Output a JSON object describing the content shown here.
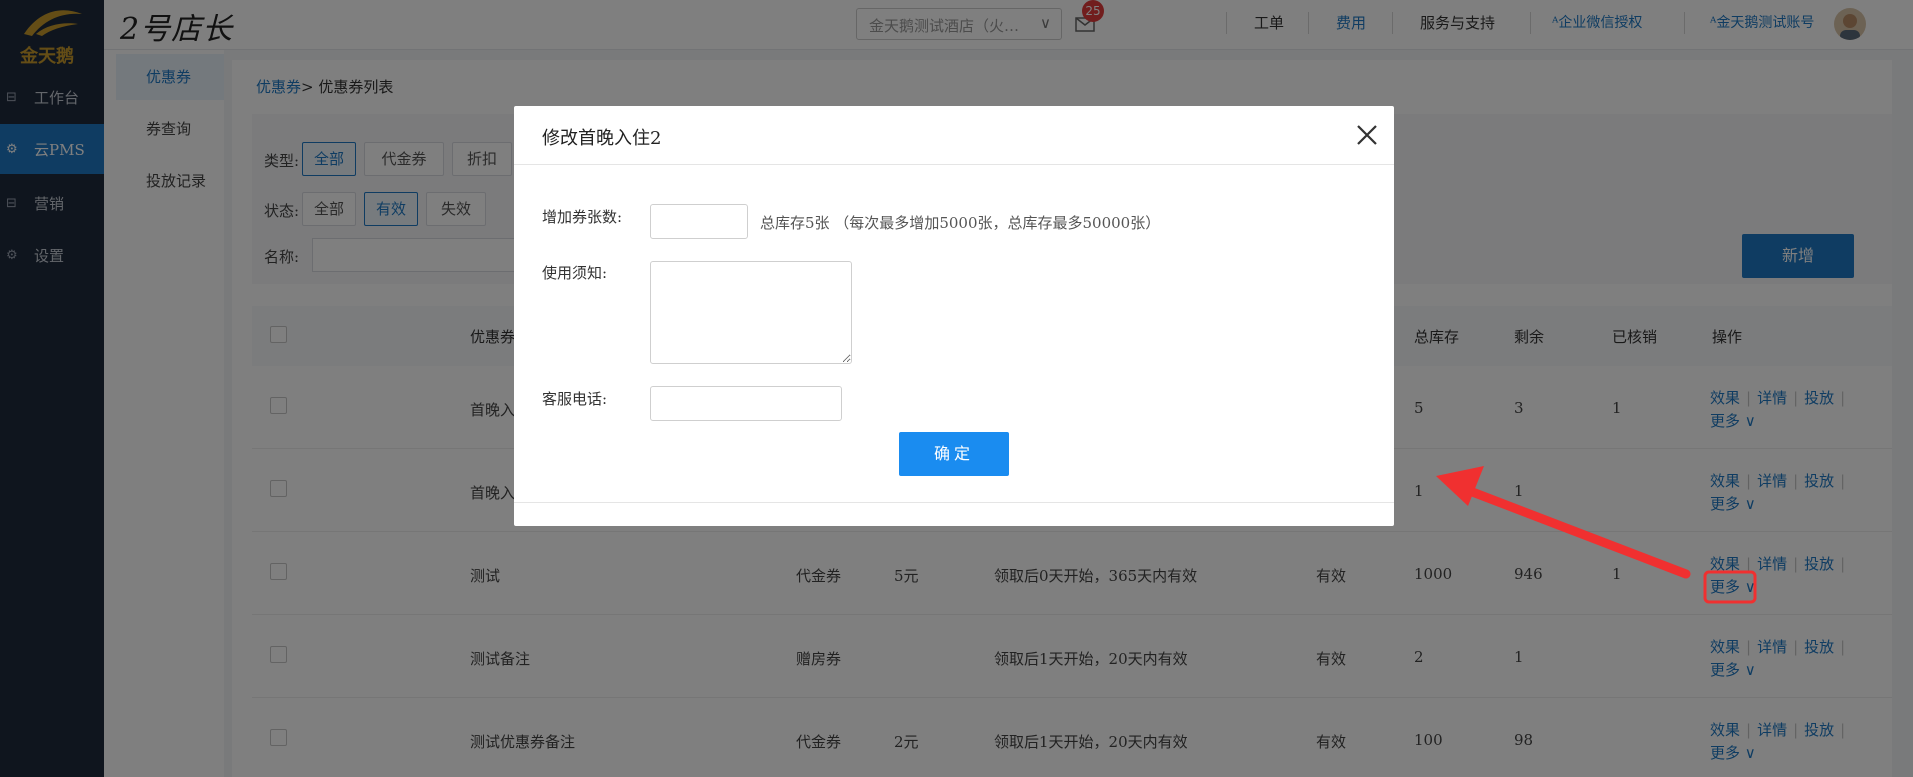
{
  "app": {
    "brand": "2号店长",
    "logo_text": "金天鹅"
  },
  "sidebar": {
    "items": [
      {
        "label": "工作台",
        "icon": "workbench-icon"
      },
      {
        "label": "云PMS",
        "icon": "gear-icon"
      },
      {
        "label": "营销",
        "icon": "marketing-icon"
      },
      {
        "label": "设置",
        "icon": "gear-icon"
      }
    ],
    "active_index": 1
  },
  "topbar": {
    "hotel_select": "金天鹅测试酒店（火…",
    "badge_count": "25",
    "links": [
      "工单",
      "费用",
      "服务与支持",
      "企业微信授权",
      "金天鹅测试账号"
    ]
  },
  "subnav": {
    "items": [
      "优惠券",
      "券查询",
      "投放记录"
    ],
    "active_index": 0
  },
  "breadcrumb": {
    "link": "优惠券",
    "current": "> 优惠券列表"
  },
  "filters": {
    "type_label": "类型:",
    "type_options": [
      "全部",
      "代金券",
      "折扣"
    ],
    "status_label": "状态:",
    "status_options": [
      "全部",
      "有效",
      "失效"
    ],
    "name_label": "名称:"
  },
  "toolbar": {
    "add_label": "新增"
  },
  "table": {
    "headers": {
      "name": "优惠券",
      "total": "总库存",
      "remaining": "剩余",
      "verified": "已核销",
      "actions": "操作"
    },
    "rows": [
      {
        "name": "首晚入",
        "type": "",
        "value": "",
        "validity": "",
        "status": "",
        "total": "5",
        "remaining": "3",
        "verified": "1"
      },
      {
        "name": "首晚入",
        "type": "",
        "value": "",
        "validity": "",
        "status": "",
        "total": "1",
        "remaining": "1",
        "verified": ""
      },
      {
        "name": "测试",
        "type": "代金券",
        "value": "5元",
        "validity": "领取后0天开始，365天内有效",
        "status": "有效",
        "total": "1000",
        "remaining": "946",
        "verified": "1"
      },
      {
        "name": "测试备注",
        "type": "赠房券",
        "value": "",
        "validity": "领取后1天开始，20天内有效",
        "status": "有效",
        "total": "2",
        "remaining": "1",
        "verified": ""
      },
      {
        "name": "测试优惠券备注",
        "type": "代金券",
        "value": "2元",
        "validity": "领取后1天开始，20天内有效",
        "status": "有效",
        "total": "100",
        "remaining": "98",
        "verified": ""
      }
    ],
    "actions": {
      "effect": "效果",
      "detail": "详情",
      "deliver": "投放",
      "more": "更多"
    }
  },
  "modal": {
    "title": "修改首晚入住2",
    "add_count_label": "增加券张数:",
    "add_count_value": "",
    "stock_hint": "总库存5张 （每次最多增加5000张，总库存最多50000张）",
    "notice_label": "使用须知:",
    "notice_value": "",
    "phone_label": "客服电话:",
    "phone_value": "",
    "confirm_label": "确定"
  },
  "colors": {
    "primary": "#1e79c5",
    "confirm": "#1a8cf0",
    "sidebar_bg": "#1f2a3c",
    "annotation_red": "#f03030"
  }
}
